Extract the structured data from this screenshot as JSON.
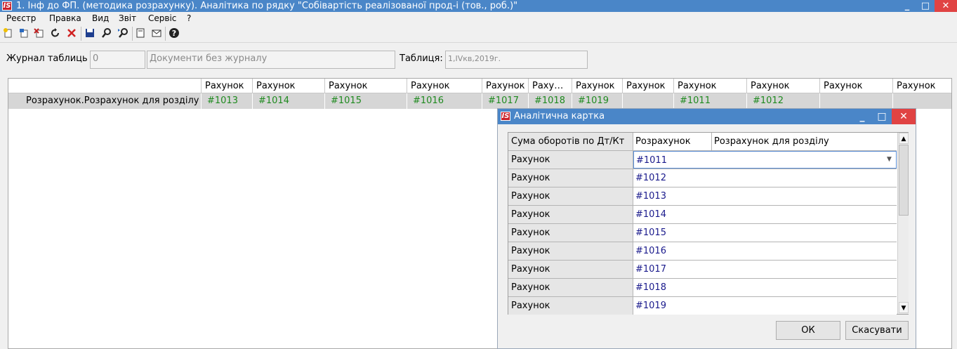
{
  "window": {
    "title": "1. Інф до ФП. (методика розрахунку). Аналітика по рядку \"Собівартість реалізованої прод-і (тов., роб.)\"",
    "logo": "IS",
    "minimize": "_",
    "maximize": "□",
    "close": "✕"
  },
  "menu": [
    "Реєстр",
    "Правка",
    "Вид",
    "Звіт",
    "Сервіс",
    "?"
  ],
  "toolbar": {
    "icons": [
      "new-doc-icon",
      "new-sub-icon",
      "delete-doc-icon",
      "refresh-icon",
      "delete-icon",
      "save-icon",
      "find-icon",
      "find-next-icon",
      "properties-icon",
      "mail-icon",
      "help-icon"
    ]
  },
  "filters": {
    "journal_label": "Журнал таблиць",
    "journal_code": "0",
    "journal_name": "Документи без журналу",
    "table_label": "Таблиця:",
    "table_value": "1,IVкв,2019г."
  },
  "grid": {
    "headers": [
      "Рахунок",
      "Рахунок",
      "Рахунок",
      "Рахунок",
      "Рахунок",
      "Раху…",
      "Рахунок",
      "Рахунок",
      "Рахунок",
      "Рахунок",
      "Рахунок",
      "Рахунок"
    ],
    "row": {
      "label": "Розрахунок.Розрахунок для розділу",
      "cells": [
        "#1013",
        "#1014",
        "#1015",
        "#1016",
        "#1017",
        "#1018",
        "#1019",
        "",
        "#1011",
        "#1012",
        "",
        ""
      ]
    }
  },
  "dialog": {
    "title": "Аналітична картка",
    "logo": "IS",
    "minimize": "_",
    "maximize": "□",
    "close": "✕",
    "header_row": {
      "label": "Сума оборотів по Дт/Кт",
      "value1": "Розрахунок",
      "value2": "Розрахунок для розділу"
    },
    "rows": [
      {
        "label": "Рахунок",
        "value": "#1011"
      },
      {
        "label": "Рахунок",
        "value": "#1012"
      },
      {
        "label": "Рахунок",
        "value": "#1013"
      },
      {
        "label": "Рахунок",
        "value": "#1014"
      },
      {
        "label": "Рахунок",
        "value": "#1015"
      },
      {
        "label": "Рахунок",
        "value": "#1016"
      },
      {
        "label": "Рахунок",
        "value": "#1017"
      },
      {
        "label": "Рахунок",
        "value": "#1018"
      },
      {
        "label": "Рахунок",
        "value": "#1019"
      }
    ],
    "ok_label": "ОК",
    "cancel_label": "Скасувати"
  },
  "colors": {
    "titlebar": "#4a86c8",
    "close_button": "#e04343",
    "account_green": "#1f8a1f",
    "value_blue": "#1a1a8c"
  }
}
